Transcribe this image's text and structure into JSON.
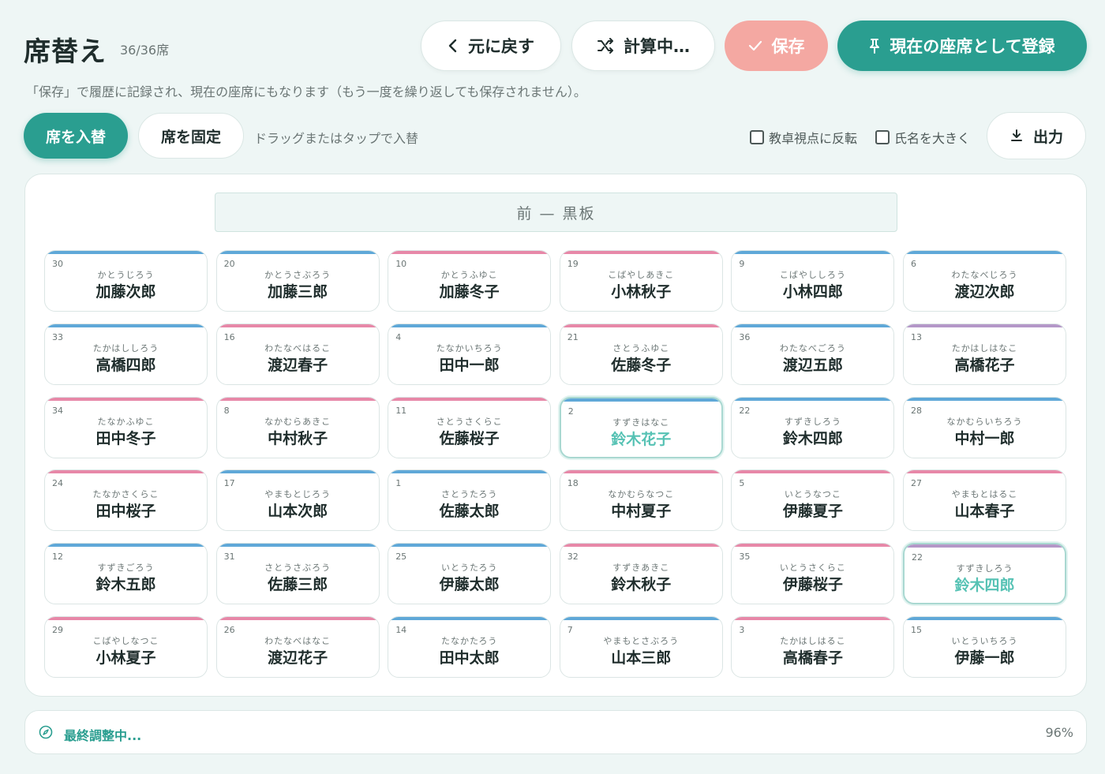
{
  "header": {
    "title": "席替え",
    "count": "36/36席",
    "undo_label": "元に戻す",
    "shuffle_label": "計算中…",
    "save_label": "保存",
    "register_label": "現在の座席として登録",
    "hint": "「保存」で履歴に記録され、現在の座席にもなります（もう一度を繰り返しても保存されません）。"
  },
  "toolbar": {
    "swap_label": "席を入替",
    "fix_label": "席を固定",
    "drag_hint": "ドラッグまたはタップで入替",
    "flip_label": "教卓視点に反転",
    "big_name_label": "氏名を大きく",
    "export_label": "出力"
  },
  "board": {
    "blackboard_label": "前 — 黒板",
    "seats": [
      {
        "num": "30",
        "kana": "かとうじろう",
        "name": "加藤次郎",
        "gender": "m"
      },
      {
        "num": "20",
        "kana": "かとうさぶろう",
        "name": "加藤三郎",
        "gender": "m"
      },
      {
        "num": "10",
        "kana": "かとうふゆこ",
        "name": "加藤冬子",
        "gender": "f"
      },
      {
        "num": "19",
        "kana": "こばやしあきこ",
        "name": "小林秋子",
        "gender": "f"
      },
      {
        "num": "9",
        "kana": "こばやししろう",
        "name": "小林四郎",
        "gender": "m"
      },
      {
        "num": "6",
        "kana": "わたなべじろう",
        "name": "渡辺次郎",
        "gender": "m"
      },
      {
        "num": "33",
        "kana": "たかはししろう",
        "name": "高橋四郎",
        "gender": "m"
      },
      {
        "num": "16",
        "kana": "わたなべはるこ",
        "name": "渡辺春子",
        "gender": "f"
      },
      {
        "num": "4",
        "kana": "たなかいちろう",
        "name": "田中一郎",
        "gender": "m"
      },
      {
        "num": "21",
        "kana": "さとうふゆこ",
        "name": "佐藤冬子",
        "gender": "f"
      },
      {
        "num": "36",
        "kana": "わたなべごろう",
        "name": "渡辺五郎",
        "gender": "m"
      },
      {
        "num": "13",
        "kana": "たかはしはなこ",
        "name": "高橋花子",
        "gender": "x"
      },
      {
        "num": "34",
        "kana": "たなかふゆこ",
        "name": "田中冬子",
        "gender": "f"
      },
      {
        "num": "8",
        "kana": "なかむらあきこ",
        "name": "中村秋子",
        "gender": "f"
      },
      {
        "num": "11",
        "kana": "さとうさくらこ",
        "name": "佐藤桜子",
        "gender": "f"
      },
      {
        "num": "2",
        "kana": "すずきはなこ",
        "name": "鈴木花子",
        "gender": "hl"
      },
      {
        "num": "22",
        "kana": "すずきしろう",
        "name": "鈴木四郎",
        "gender": "m"
      },
      {
        "num": "28",
        "kana": "なかむらいちろう",
        "name": "中村一郎",
        "gender": "m"
      },
      {
        "num": "24",
        "kana": "たなかさくらこ",
        "name": "田中桜子",
        "gender": "f"
      },
      {
        "num": "17",
        "kana": "やまもとじろう",
        "name": "山本次郎",
        "gender": "m"
      },
      {
        "num": "1",
        "kana": "さとうたろう",
        "name": "佐藤太郎",
        "gender": "m"
      },
      {
        "num": "18",
        "kana": "なかむらなつこ",
        "name": "中村夏子",
        "gender": "f"
      },
      {
        "num": "5",
        "kana": "いとうなつこ",
        "name": "伊藤夏子",
        "gender": "f"
      },
      {
        "num": "27",
        "kana": "やまもとはるこ",
        "name": "山本春子",
        "gender": "f"
      },
      {
        "num": "12",
        "kana": "すずきごろう",
        "name": "鈴木五郎",
        "gender": "m"
      },
      {
        "num": "31",
        "kana": "さとうさぶろう",
        "name": "佐藤三郎",
        "gender": "m"
      },
      {
        "num": "25",
        "kana": "いとうたろう",
        "name": "伊藤太郎",
        "gender": "m"
      },
      {
        "num": "32",
        "kana": "すずきあきこ",
        "name": "鈴木秋子",
        "gender": "f"
      },
      {
        "num": "35",
        "kana": "いとうさくらこ",
        "name": "伊藤桜子",
        "gender": "f"
      },
      {
        "num": "22",
        "kana": "すずきしろう",
        "name": "鈴木四郎",
        "gender": "xhl"
      },
      {
        "num": "29",
        "kana": "こばやしなつこ",
        "name": "小林夏子",
        "gender": "f"
      },
      {
        "num": "26",
        "kana": "わたなべはなこ",
        "name": "渡辺花子",
        "gender": "f"
      },
      {
        "num": "14",
        "kana": "たなかたろう",
        "name": "田中太郎",
        "gender": "m"
      },
      {
        "num": "7",
        "kana": "やまもとさぶろう",
        "name": "山本三郎",
        "gender": "m"
      },
      {
        "num": "3",
        "kana": "たかはしはるこ",
        "name": "高橋春子",
        "gender": "f"
      },
      {
        "num": "15",
        "kana": "いとういちろう",
        "name": "伊藤一郎",
        "gender": "m"
      }
    ]
  },
  "status": {
    "label": "最終調整中...",
    "progress": "96%"
  },
  "colors": {
    "accent": "#2a9e90",
    "save_disabled": "#f4a8a2",
    "male_stripe": "#5fa8d8",
    "female_stripe": "#e788a8",
    "other_stripe": "#b497c8",
    "highlight_name": "#56c2b4"
  }
}
